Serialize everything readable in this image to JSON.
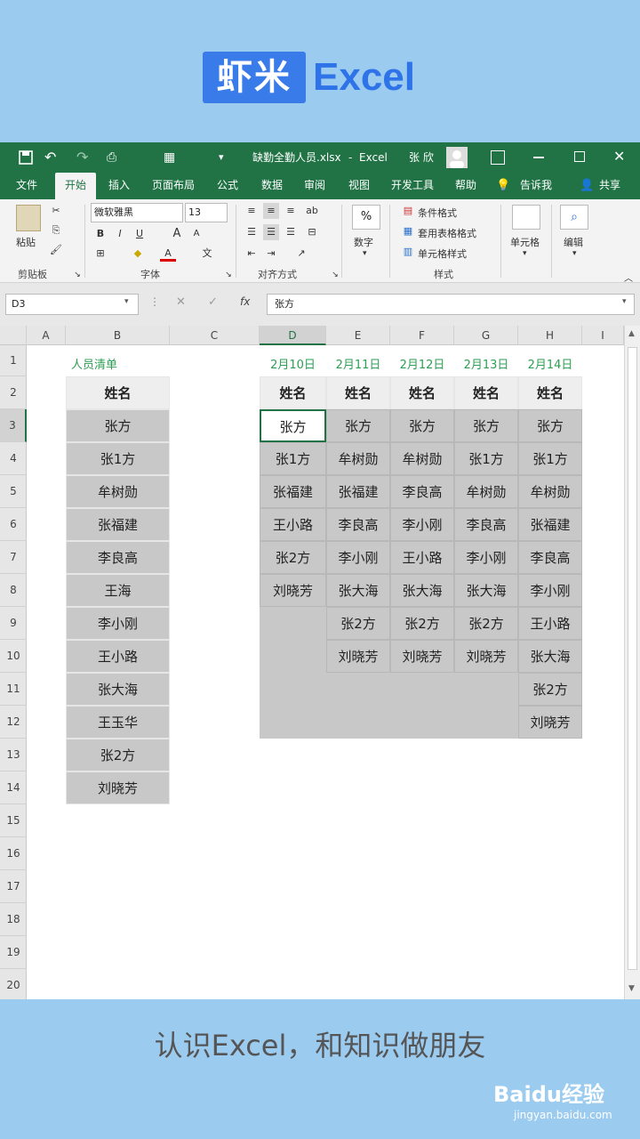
{
  "banner": {
    "logo_box": "虾米",
    "logo_text": "Excel"
  },
  "window": {
    "filename": "缺勤全勤人员.xlsx",
    "app": "Excel",
    "user": "张 欣",
    "separator": "-"
  },
  "tabs": [
    "文件",
    "开始",
    "插入",
    "页面布局",
    "公式",
    "数据",
    "审阅",
    "视图",
    "开发工具",
    "帮助",
    "告诉我",
    "共享"
  ],
  "ribbon": {
    "paste_label": "粘贴",
    "font_name": "微软雅黑",
    "font_size": "13",
    "number_label": "数字",
    "cond_format": "条件格式",
    "table_format": "套用表格格式",
    "cell_style": "单元格样式",
    "cells_label": "单元格",
    "edit_label": "编辑",
    "groups": {
      "clipboard": "剪贴板",
      "font": "字体",
      "align": "对齐方式",
      "styles": "样式"
    },
    "bold": "B",
    "italic": "I",
    "underline": "U",
    "percent": "%",
    "font_grow": "A",
    "font_shrink": "A",
    "font_color": "A"
  },
  "formula_bar": {
    "namebox": "D3",
    "fx": "fx",
    "content": "张方"
  },
  "columns": [
    "A",
    "B",
    "C",
    "D",
    "E",
    "F",
    "G",
    "H",
    "I"
  ],
  "rows": [
    "1",
    "2",
    "3",
    "4",
    "5",
    "6",
    "7",
    "8",
    "9",
    "10",
    "11",
    "12",
    "13",
    "14",
    "15",
    "16",
    "17",
    "18",
    "19",
    "20"
  ],
  "sheet": {
    "list_title": "人员清单",
    "header": "姓名",
    "staff": [
      "张方",
      "张1方",
      "牟树勋",
      "张福建",
      "李良高",
      "王海",
      "李小刚",
      "王小路",
      "张大海",
      "王玉华",
      "张2方",
      "刘晓芳"
    ],
    "dates": [
      "2月10日",
      "2月11日",
      "2月12日",
      "2月13日",
      "2月14日"
    ],
    "attendance": [
      [
        "张方",
        "张1方",
        "张福建",
        "王小路",
        "张2方",
        "刘晓芳"
      ],
      [
        "张方",
        "牟树勋",
        "张福建",
        "李良高",
        "李小刚",
        "张大海",
        "张2方",
        "刘晓芳"
      ],
      [
        "张方",
        "牟树勋",
        "李良高",
        "李小刚",
        "王小路",
        "张大海",
        "张2方",
        "刘晓芳"
      ],
      [
        "张方",
        "张1方",
        "牟树勋",
        "李良高",
        "李小刚",
        "张大海",
        "张2方",
        "刘晓芳"
      ],
      [
        "张方",
        "张1方",
        "牟树勋",
        "张福建",
        "李良高",
        "李小刚",
        "王小路",
        "张大海",
        "张2方",
        "刘晓芳"
      ]
    ]
  },
  "footer": {
    "slogan": "认识Excel，和知识做朋友",
    "watermark": "Baidu经验",
    "watermark_url": "jingyan.baidu.com"
  }
}
